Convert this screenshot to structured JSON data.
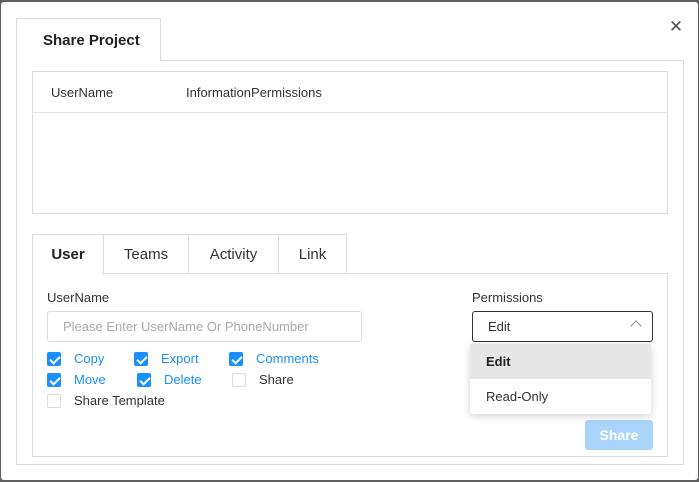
{
  "dialog": {
    "tab_label": "Share Project",
    "close_glyph": "✕"
  },
  "members_table": {
    "columns": [
      "UserName",
      "InformationPermissions"
    ],
    "rows": []
  },
  "sub_tabs": [
    {
      "label": "User",
      "active": true
    },
    {
      "label": "Teams",
      "active": false
    },
    {
      "label": "Activity",
      "active": false
    },
    {
      "label": "Link",
      "active": false
    }
  ],
  "form": {
    "username_label": "UserName",
    "username_placeholder": "Please Enter UserName Or PhoneNumber",
    "username_value": "",
    "permissions_label": "Permissions",
    "permissions_value": "Edit",
    "checkboxes": [
      {
        "label": "Copy",
        "checked": true
      },
      {
        "label": "Export",
        "checked": true
      },
      {
        "label": "Comments",
        "checked": true
      },
      {
        "label": "Move",
        "checked": true
      },
      {
        "label": "Delete",
        "checked": true
      },
      {
        "label": "Share",
        "checked": false
      },
      {
        "label": "Share Template",
        "checked": false
      }
    ],
    "share_button": "Share"
  },
  "permissions_dropdown": {
    "options": [
      {
        "label": "Edit",
        "selected": true
      },
      {
        "label": "Read-Only",
        "selected": false
      }
    ]
  },
  "colors": {
    "accent": "#1890ff",
    "disabled_button": "#a9d4fb",
    "overlay": "#5f5f5f"
  }
}
